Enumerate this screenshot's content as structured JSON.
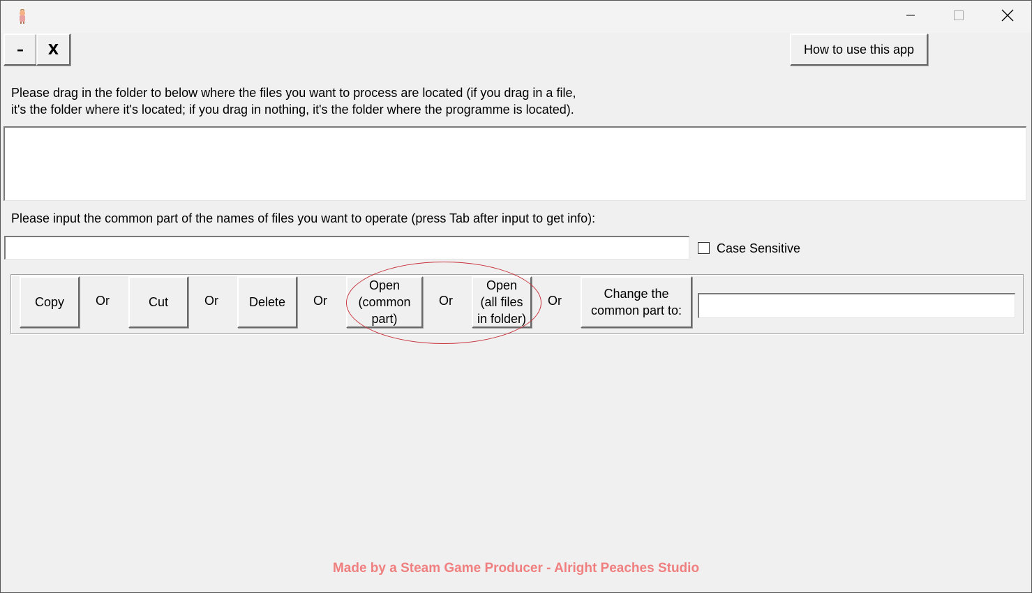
{
  "titlebar": {
    "app_icon": "peach-character-icon",
    "minimize_icon": "minimize-icon",
    "maximize_icon": "maximize-icon",
    "close_icon": "close-icon"
  },
  "toolbar": {
    "collapse_label": "–",
    "close_label": "X",
    "help_label": "How to use this app"
  },
  "folder": {
    "instruction": "Please drag in the folder to below where the files you want to process are located (if you drag in a file,\nit's the folder where it's located; if you drag in nothing, it's the folder where the programme is located).",
    "value": ""
  },
  "common_part": {
    "instruction": "Please input the common part of the names of files you want to operate (press Tab after input to get info):",
    "value": "",
    "case_sensitive_label": "Case Sensitive",
    "case_sensitive_checked": false
  },
  "actions": {
    "copy": "Copy",
    "cut": "Cut",
    "delete": "Delete",
    "open_common": "Open\n(common\npart)",
    "open_all": "Open\n(all files\nin folder)",
    "change": "Change the\ncommon part to:",
    "or": "Or",
    "change_value": ""
  },
  "footer": {
    "credit": "Made by a Steam Game Producer - Alright Peaches Studio",
    "color": "#f08080"
  },
  "annotation": {
    "color": "#c8323c"
  }
}
